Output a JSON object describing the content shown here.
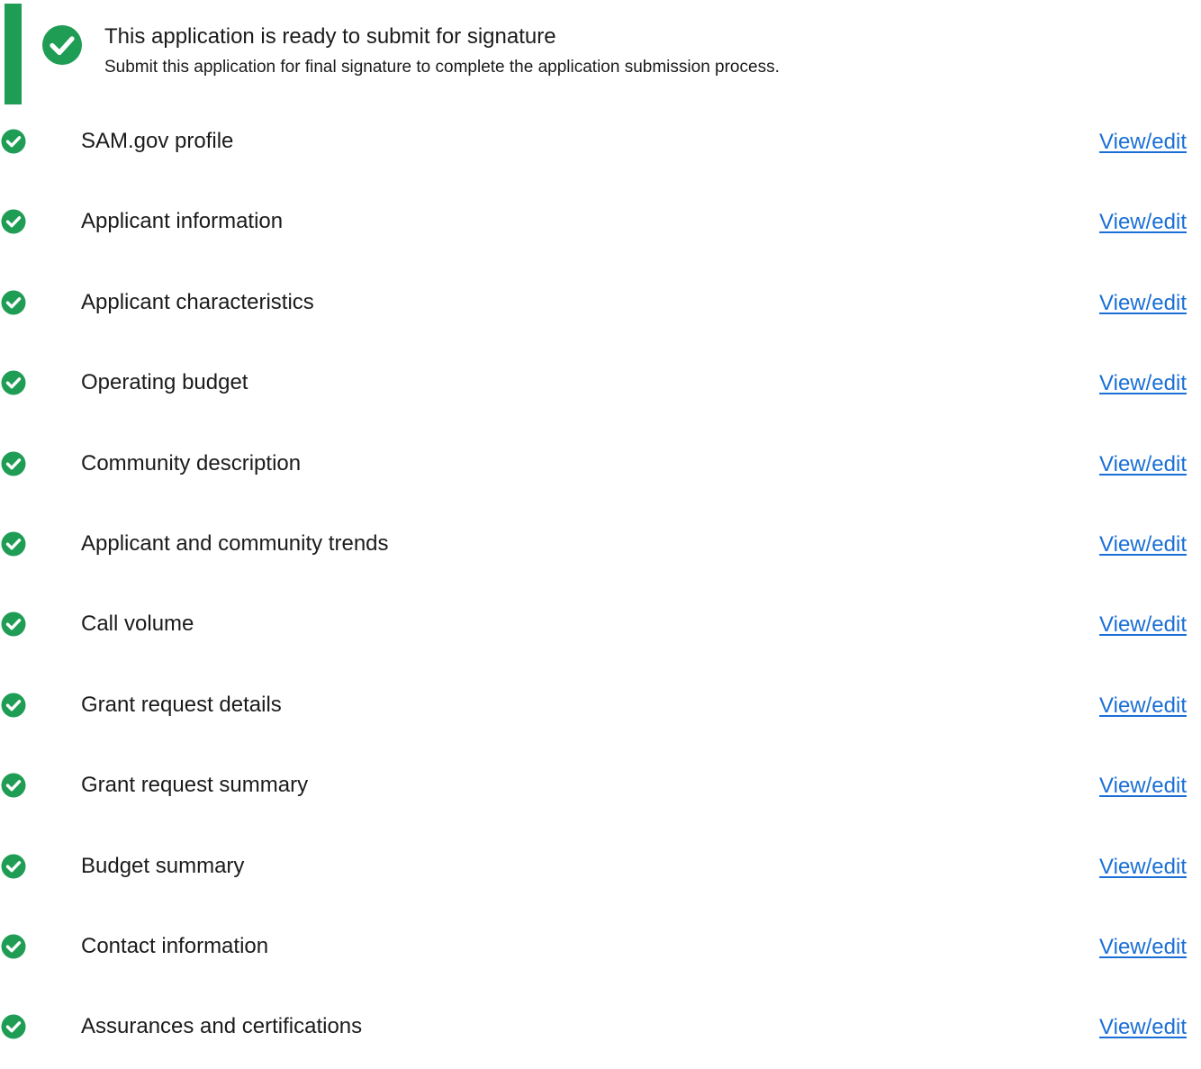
{
  "alert": {
    "heading": "This application is ready to submit for signature",
    "body": "Submit this application for final signature to complete the application submission process.",
    "icon": "check-circle-icon",
    "color": "#1f9d55"
  },
  "tasks": [
    {
      "label": "SAM.gov profile",
      "link": "View/edit"
    },
    {
      "label": "Applicant information",
      "link": "View/edit"
    },
    {
      "label": "Applicant characteristics",
      "link": "View/edit"
    },
    {
      "label": "Operating budget",
      "link": "View/edit"
    },
    {
      "label": "Community description",
      "link": "View/edit"
    },
    {
      "label": "Applicant and community trends",
      "link": "View/edit"
    },
    {
      "label": "Call volume",
      "link": "View/edit"
    },
    {
      "label": "Grant request details",
      "link": "View/edit"
    },
    {
      "label": "Grant request summary",
      "link": "View/edit"
    },
    {
      "label": "Budget summary",
      "link": "View/edit"
    },
    {
      "label": "Contact information",
      "link": "View/edit"
    },
    {
      "label": "Assurances and certifications",
      "link": "View/edit"
    }
  ],
  "colors": {
    "success": "#1f9d55",
    "link": "#1a6fd6",
    "text": "#1b1b1b"
  }
}
